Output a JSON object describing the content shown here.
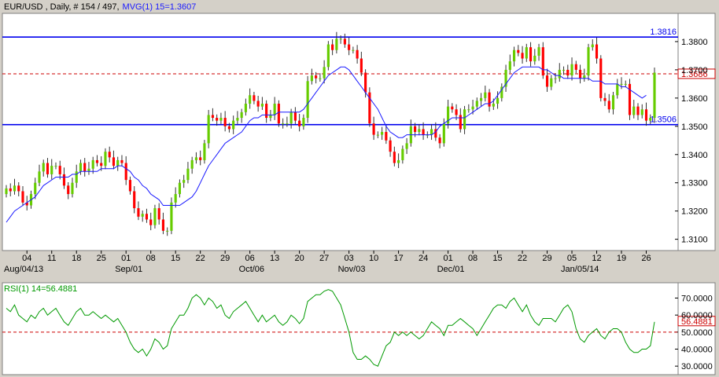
{
  "colors": {
    "up": "#66cc00",
    "down": "#ff0000",
    "ma": "#1a1aff",
    "hline": "#0000ee",
    "rsi": "#009900",
    "dashed": "#cc0000"
  },
  "header": {
    "symbol": "EUR/USD",
    "info": " , Daily, # 154 / 497,",
    "mvg_label": "MVG(1) 15=1.3607"
  },
  "rsi_header": {
    "label": "RSI(1) 14=56.4881"
  },
  "chart_data": [
    {
      "type": "candlestick",
      "ylim": [
        1.306,
        1.39
      ],
      "yticks": [
        "1.3800",
        "1.3700",
        "1.3600",
        "1.3500",
        "1.3400",
        "1.3300",
        "1.3200",
        "1.3100"
      ],
      "xticks": [
        "04",
        "11",
        "18",
        "25",
        "01",
        "08",
        "15",
        "22",
        "29",
        "06",
        "13",
        "20",
        "27",
        "03",
        "10",
        "17",
        "24",
        "01",
        "08",
        "15",
        "22",
        "29",
        "05",
        "12",
        "19",
        "26"
      ],
      "xlabels": [
        "Aug/04/13",
        "Sep/01",
        "Oct/06",
        "Nov/03",
        "Dec/01",
        "Jan/05/14"
      ],
      "levels": [
        {
          "value": 1.3816,
          "label": "1.3816"
        },
        {
          "value": 1.3506,
          "label": "1.3506"
        }
      ],
      "current": {
        "value": 1.3686,
        "label": "1.3686"
      },
      "series": [
        {
          "name": "EUR/USD",
          "close": [
            1.328,
            1.327,
            1.329,
            1.327,
            1.323,
            1.322,
            1.326,
            1.33,
            1.334,
            1.337,
            1.333,
            1.336,
            1.336,
            1.333,
            1.329,
            1.326,
            1.33,
            1.334,
            1.337,
            1.334,
            1.335,
            1.338,
            1.337,
            1.336,
            1.341,
            1.339,
            1.336,
            1.338,
            1.337,
            1.331,
            1.327,
            1.321,
            1.318,
            1.319,
            1.317,
            1.315,
            1.321,
            1.317,
            1.313,
            1.313,
            1.323,
            1.326,
            1.33,
            1.331,
            1.335,
            1.338,
            1.339,
            1.338,
            1.344,
            1.354,
            1.353,
            1.352,
            1.353,
            1.35,
            1.349,
            1.352,
            1.353,
            1.355,
            1.358,
            1.361,
            1.359,
            1.357,
            1.358,
            1.353,
            1.354,
            1.358,
            1.351,
            1.351,
            1.351,
            1.355,
            1.352,
            1.35,
            1.353,
            1.366,
            1.368,
            1.367,
            1.367,
            1.371,
            1.379,
            1.377,
            1.381,
            1.381,
            1.379,
            1.377,
            1.377,
            1.374,
            1.369,
            1.362,
            1.351,
            1.347,
            1.347,
            1.348,
            1.345,
            1.341,
            1.337,
            1.338,
            1.342,
            1.344,
            1.35,
            1.348,
            1.349,
            1.347,
            1.347,
            1.349,
            1.346,
            1.344,
            1.351,
            1.357,
            1.356,
            1.354,
            1.349,
            1.356,
            1.356,
            1.357,
            1.359,
            1.36,
            1.362,
            1.357,
            1.358,
            1.36,
            1.364,
            1.37,
            1.373,
            1.377,
            1.376,
            1.374,
            1.378,
            1.373,
            1.375,
            1.378,
            1.368,
            1.364,
            1.367,
            1.367,
            1.37,
            1.37,
            1.368,
            1.372,
            1.37,
            1.367,
            1.368,
            1.378,
            1.379,
            1.374,
            1.36,
            1.359,
            1.356,
            1.361,
            1.365,
            1.365,
            1.365,
            1.354,
            1.357,
            1.354,
            1.356,
            1.352,
            1.353,
            1.369
          ]
        },
        {
          "name": "MVG(1) 15",
          "values": [
            1.316,
            1.318,
            1.32,
            1.321,
            1.322,
            1.323,
            1.324,
            1.325,
            1.327,
            1.329,
            1.33,
            1.331,
            1.332,
            1.332,
            1.332,
            1.332,
            1.333,
            1.333,
            1.334,
            1.334,
            1.334,
            1.334,
            1.334,
            1.335,
            1.335,
            1.335,
            1.335,
            1.336,
            1.336,
            1.335,
            1.334,
            1.332,
            1.331,
            1.329,
            1.328,
            1.326,
            1.325,
            1.324,
            1.322,
            1.322,
            1.322,
            1.322,
            1.322,
            1.323,
            1.324,
            1.325,
            1.327,
            1.33,
            1.333,
            1.336,
            1.338,
            1.34,
            1.342,
            1.344,
            1.345,
            1.346,
            1.347,
            1.348,
            1.35,
            1.352,
            1.353,
            1.353,
            1.354,
            1.354,
            1.354,
            1.354,
            1.355,
            1.355,
            1.355,
            1.355,
            1.355,
            1.355,
            1.356,
            1.358,
            1.36,
            1.362,
            1.364,
            1.366,
            1.368,
            1.369,
            1.37,
            1.371,
            1.371,
            1.37,
            1.368,
            1.366,
            1.364,
            1.362,
            1.36,
            1.358,
            1.356,
            1.353,
            1.35,
            1.348,
            1.347,
            1.346,
            1.346,
            1.347,
            1.347,
            1.347,
            1.347,
            1.347,
            1.347,
            1.347,
            1.348,
            1.35,
            1.351,
            1.352,
            1.353,
            1.353,
            1.353,
            1.353,
            1.354,
            1.355,
            1.356,
            1.357,
            1.358,
            1.358,
            1.359,
            1.361,
            1.363,
            1.365,
            1.367,
            1.369,
            1.37,
            1.371,
            1.371,
            1.371,
            1.371,
            1.371,
            1.37,
            1.37,
            1.369,
            1.368,
            1.368,
            1.367,
            1.367,
            1.367,
            1.367,
            1.367,
            1.367,
            1.367,
            1.366,
            1.366,
            1.366,
            1.365,
            1.365,
            1.365,
            1.365,
            1.364,
            1.364,
            1.363,
            1.362,
            1.361,
            1.36,
            1.361
          ]
        }
      ]
    },
    {
      "type": "line",
      "ylim": [
        25,
        79
      ],
      "yticks": [
        "70.0000",
        "60.0000",
        "50.0000",
        "40.0000",
        "30.0000"
      ],
      "level": {
        "value": 50,
        "label": "50.0000"
      },
      "current": {
        "value": 56.4881,
        "label": "56.4881"
      },
      "series": [
        {
          "name": "RSI(1) 14",
          "values": [
            64,
            62,
            66,
            60,
            58,
            56,
            60,
            58,
            62,
            64,
            60,
            62,
            64,
            60,
            56,
            54,
            58,
            62,
            64,
            60,
            60,
            62,
            60,
            58,
            60,
            58,
            56,
            58,
            54,
            50,
            44,
            40,
            38,
            40,
            36,
            40,
            46,
            44,
            40,
            42,
            52,
            56,
            60,
            60,
            64,
            70,
            72,
            70,
            66,
            70,
            68,
            64,
            66,
            60,
            58,
            62,
            64,
            66,
            68,
            64,
            60,
            56,
            60,
            56,
            58,
            60,
            56,
            54,
            56,
            60,
            58,
            55,
            58,
            68,
            70,
            72,
            72,
            74,
            75,
            74,
            70,
            66,
            58,
            50,
            38,
            34,
            34,
            36,
            34,
            31,
            30,
            36,
            42,
            44,
            50,
            48,
            50,
            48,
            50,
            48,
            46,
            48,
            52,
            56,
            54,
            52,
            48,
            54,
            54,
            56,
            58,
            56,
            54,
            52,
            48,
            52,
            56,
            60,
            64,
            66,
            66,
            64,
            68,
            70,
            66,
            62,
            66,
            60,
            56,
            54,
            58,
            58,
            58,
            56,
            60,
            64,
            66,
            62,
            52,
            46,
            44,
            48,
            50,
            52,
            48,
            46,
            50,
            52,
            52,
            50,
            44,
            40,
            38,
            38,
            40,
            40,
            42,
            56
          ]
        }
      ]
    }
  ]
}
